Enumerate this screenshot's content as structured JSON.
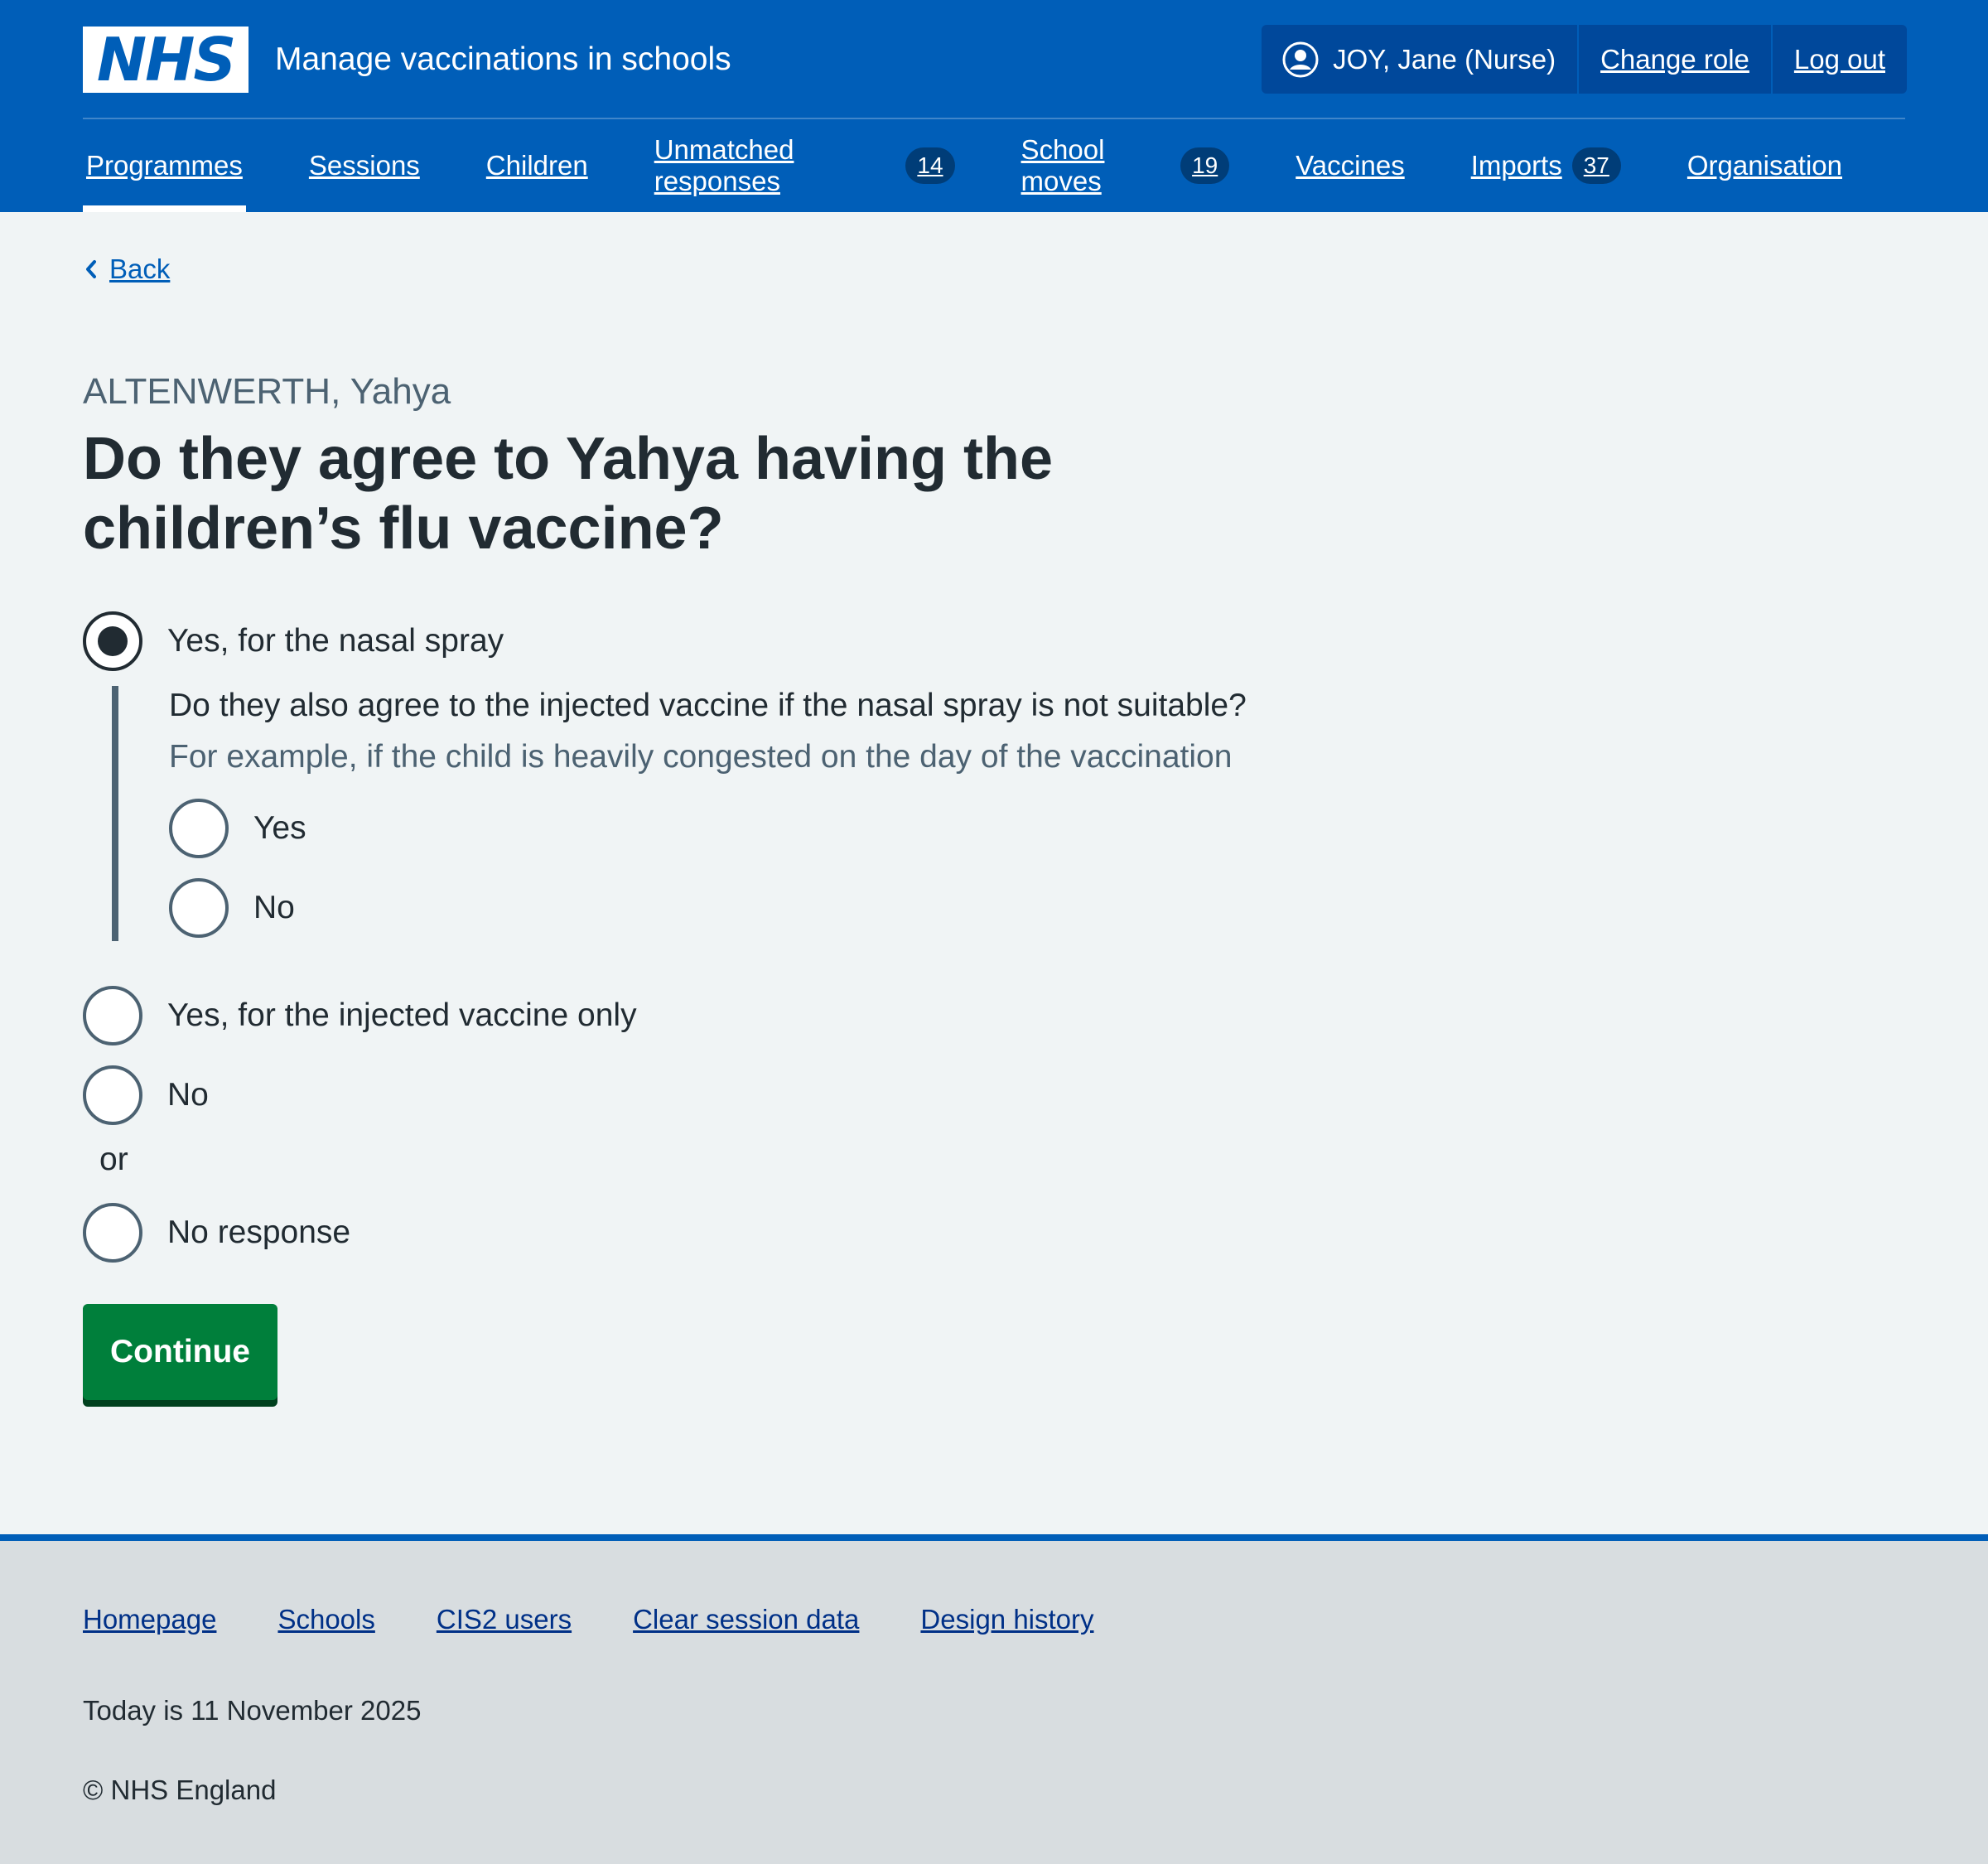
{
  "header": {
    "logo_text": "NHS",
    "service_name": "Manage vaccinations in schools",
    "user_name": "JOY, Jane (Nurse)",
    "change_role": "Change role",
    "log_out": "Log out"
  },
  "nav": {
    "items": [
      {
        "label": "Programmes",
        "active": true
      },
      {
        "label": "Sessions"
      },
      {
        "label": "Children"
      },
      {
        "label": "Unmatched responses",
        "count": "14"
      },
      {
        "label": "School moves",
        "count": "19"
      },
      {
        "label": "Vaccines"
      },
      {
        "label": "Imports",
        "count": "37"
      },
      {
        "label": "Organisation"
      }
    ]
  },
  "main": {
    "back_label": "Back",
    "caption": "ALTENWERTH, Yahya",
    "heading": "Do they agree to Yahya having the children’s flu vaccine?",
    "options": {
      "nasal": {
        "label": "Yes, for the nasal spray",
        "checked": true
      },
      "injected_only": {
        "label": "Yes, for the injected vaccine only",
        "checked": false
      },
      "no": {
        "label": "No",
        "checked": false
      },
      "or_divider": "or",
      "no_response": {
        "label": "No response",
        "checked": false
      }
    },
    "conditional": {
      "question": "Do they also agree to the injected vaccine if the nasal spray is not suitable?",
      "hint": "For example, if the child is heavily congested on the day of the vaccination",
      "yes": "Yes",
      "no": "No"
    },
    "continue_label": "Continue"
  },
  "footer": {
    "links": [
      "Homepage",
      "Schools",
      "CIS2 users",
      "Clear session data",
      "Design history"
    ],
    "date_text": "Today is 11 November 2025",
    "copyright": "© NHS England"
  },
  "colors": {
    "brand_blue": "#005eb8",
    "background": "#f0f4f5",
    "button_green": "#007f3b",
    "footer_bg": "#d8dde0"
  }
}
